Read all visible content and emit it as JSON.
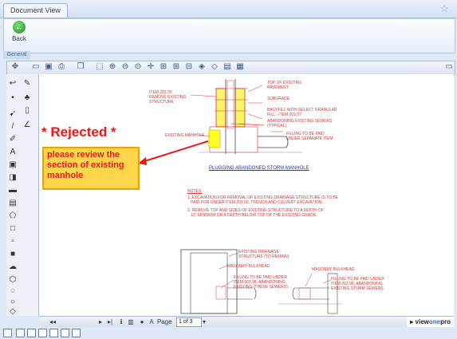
{
  "tab": {
    "title": "Document View"
  },
  "ribbon": {
    "back_label": "Back",
    "group_label": "General"
  },
  "toolbar": {
    "icons": [
      "pan-icon",
      "open-icon",
      "save-icon",
      "print-icon",
      "copy-icon",
      "select-icon",
      "zoom-in-icon",
      "zoom-out-icon",
      "zoom-window-icon",
      "fit-page-icon",
      "fit-width-icon",
      "rotate-left-icon",
      "rotate-right-icon",
      "compare-icon",
      "layers-icon",
      "settings-icon"
    ]
  },
  "annotation": {
    "rejected_text": "* Rejected *",
    "note_text": "please review the section of existing manhole",
    "highlight_color": "#ffff33",
    "arrow_color": "#e81818"
  },
  "drawing": {
    "title": "PLUGGING ABANDONED STORM MANHOLE"
  },
  "navigation": {
    "page_label": "Page",
    "page_value": "1 of 3",
    "logo_text_a": "view",
    "logo_text_b": "one",
    "logo_text_c": "pro"
  }
}
